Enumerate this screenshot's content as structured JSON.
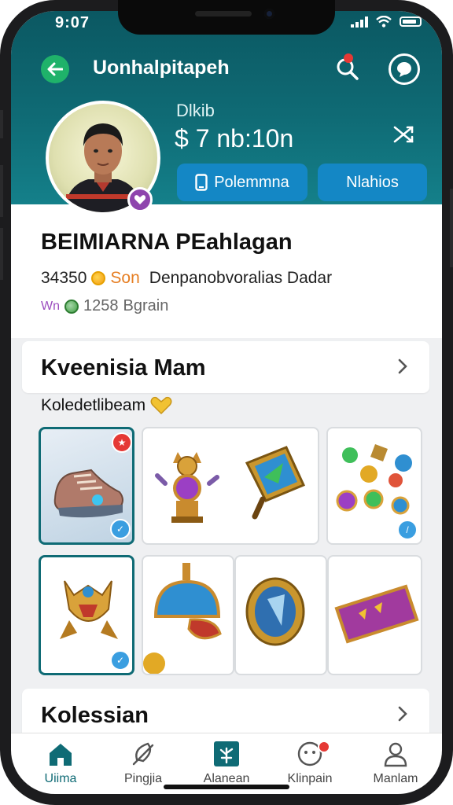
{
  "status": {
    "time": "9:07"
  },
  "header": {
    "title": "Uonhalpitapeh",
    "sub_label": "Dlkib",
    "balance": "$ 7 nb:10n",
    "pill_1": "Polemmna",
    "pill_2": "Nlahios"
  },
  "profile": {
    "name": "BEIMIARNA PEahlagan",
    "stat_value": "34350",
    "stat_orange": "Son",
    "stat_desc": "Denpanobvoralias Dadar",
    "stat2_prefix": "Wn",
    "stat2_value": "1258",
    "stat2_label": "Bgrain"
  },
  "section1": {
    "title": "Kveenisia Mam",
    "subtitle": "Koledetlibeam"
  },
  "section2": {
    "title": "Kolessian"
  },
  "nav": [
    {
      "label": "Uiima",
      "icon": "home-icon"
    },
    {
      "label": "Pingjia",
      "icon": "feather-icon"
    },
    {
      "label": "Alanean",
      "icon": "tree-icon"
    },
    {
      "label": "Klinpain",
      "icon": "chat-icon"
    },
    {
      "label": "Manlam",
      "icon": "user-icon"
    }
  ],
  "colors": {
    "header": "#0f6b75",
    "accent_green": "#1fb26a",
    "pill_blue": "#1487c5",
    "badge_red": "#e53935"
  }
}
